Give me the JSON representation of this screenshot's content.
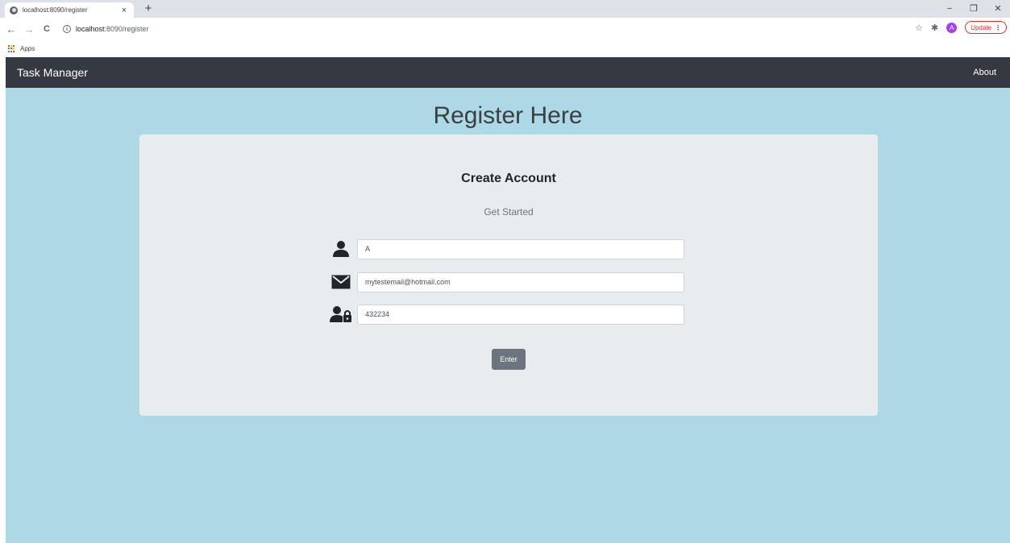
{
  "browser": {
    "tab_title": "localhost:8090/register",
    "tab_close": "×",
    "new_tab": "+",
    "window_controls": {
      "minimize": "−",
      "restore": "❐",
      "close": "✕"
    },
    "nav": {
      "back": "←",
      "forward": "→",
      "reload": "C"
    },
    "url_host": "localhost",
    "url_path": ":8090/register",
    "info_icon": "i",
    "star_icon": "☆",
    "extensions_icon": "✱",
    "profile_initial": "A",
    "update_label": "Update",
    "update_menu": "⋮",
    "bookmarks": {
      "apps_label": "Apps",
      "apps_colors": [
        "#ea4335",
        "#fbbc05",
        "#34a853",
        "#4285f4",
        "#ea4335",
        "#fbbc05",
        "#34a853",
        "#4285f4",
        "#ea4335"
      ]
    }
  },
  "navbar": {
    "brand": "Task Manager",
    "about": "About",
    "background": "#343a40"
  },
  "page": {
    "heading": "Register Here",
    "background": "#add8e6"
  },
  "form": {
    "title": "Create Account",
    "subtitle": "Get Started",
    "fields": [
      {
        "icon": "user-icon",
        "value": "A"
      },
      {
        "icon": "envelope-icon",
        "value": "mytestemail@hotmail.com"
      },
      {
        "icon": "user-lock-icon",
        "value": "432234"
      }
    ],
    "submit_label": "Enter"
  }
}
